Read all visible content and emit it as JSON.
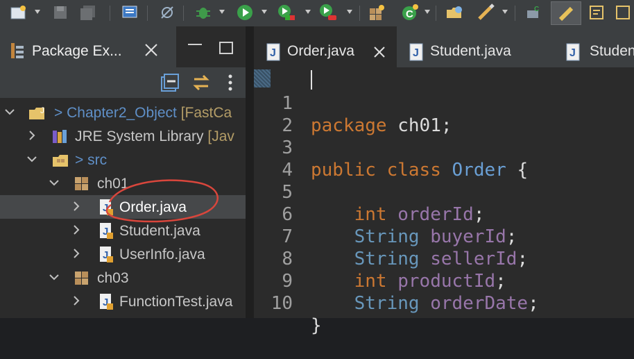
{
  "toolbar": {
    "icons": [
      "new-icon",
      "save-icon",
      "save-all-icon",
      "terminal-icon",
      "skip-breakpoints-icon",
      "debug-icon",
      "run-icon",
      "run-coverage-icon",
      "external-tools-icon",
      "new-class-icon",
      "new-java-element-icon",
      "open-type-icon",
      "search-icon",
      "pin-editor-icon",
      "toggle-mark-icon",
      "next-annotation-icon"
    ]
  },
  "package_explorer": {
    "title": "Package Ex...",
    "tree": [
      {
        "label_prefix": "> ",
        "label": "Chapter2_Object",
        "suffix": "[FastCa",
        "expanded": true,
        "icon": "project-icon"
      },
      {
        "label": "JRE System Library",
        "suffix": "[Jav",
        "expanded": false,
        "icon": "library-icon"
      },
      {
        "label_prefix": "> ",
        "label": "src",
        "expanded": true,
        "icon": "source-folder-icon"
      },
      {
        "label": "ch01",
        "expanded": true,
        "icon": "package-icon"
      },
      {
        "label": "Order.java",
        "expanded": false,
        "icon": "java-file-icon",
        "selected": true
      },
      {
        "label": "Student.java",
        "expanded": false,
        "icon": "java-file-icon"
      },
      {
        "label": "UserInfo.java",
        "expanded": false,
        "icon": "java-file-icon"
      },
      {
        "label": "ch03",
        "expanded": true,
        "icon": "package-icon"
      },
      {
        "label": "FunctionTest.java",
        "expanded": false,
        "icon": "java-file-icon"
      }
    ]
  },
  "editor": {
    "tabs": [
      {
        "label": "Order.java",
        "active": true
      },
      {
        "label": "Student.java",
        "active": false
      },
      {
        "label": "Studen",
        "active": false
      }
    ],
    "lines": [
      {
        "num": "1",
        "text": "package ch01;"
      },
      {
        "num": "2",
        "text": ""
      },
      {
        "num": "3",
        "text": "public class Order {"
      },
      {
        "num": "4",
        "text": ""
      },
      {
        "num": "5",
        "text": "    int orderId;"
      },
      {
        "num": "6",
        "text": "    String buyerId;"
      },
      {
        "num": "7",
        "text": "    String sellerId;"
      },
      {
        "num": "8",
        "text": "    int productId;"
      },
      {
        "num": "9",
        "text": "    String orderDate;"
      },
      {
        "num": "10",
        "text": "}"
      }
    ]
  },
  "colors": {
    "keyword": "#cc7832",
    "type": "#6897bb",
    "field": "#9876aa",
    "annotation_circle": "#d9463c"
  }
}
